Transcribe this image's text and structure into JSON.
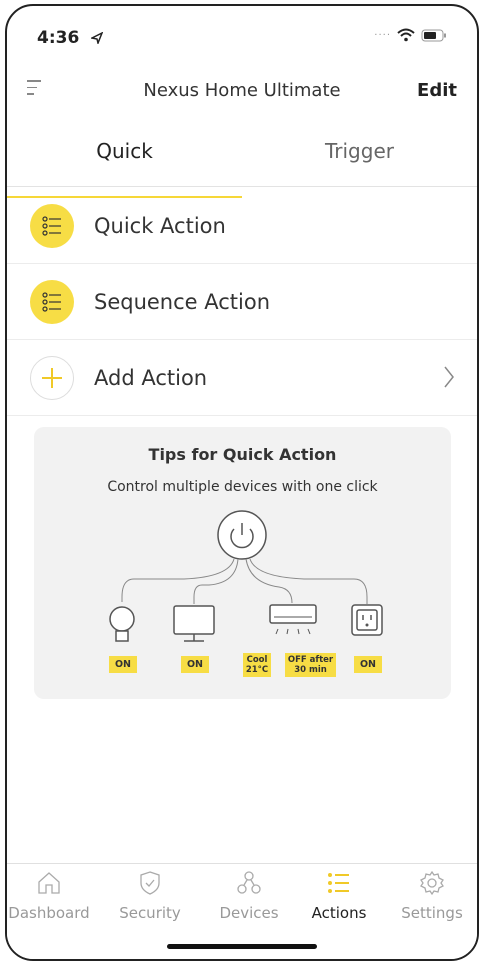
{
  "status": {
    "time": "4:36"
  },
  "nav": {
    "title": "Nexus Home Ultimate",
    "edit_label": "Edit"
  },
  "tabs": [
    {
      "label": "Quick"
    },
    {
      "label": "Trigger"
    }
  ],
  "actions": [
    {
      "label": "Quick Action",
      "icon": "list-icon"
    },
    {
      "label": "Sequence Action",
      "icon": "list-icon"
    },
    {
      "label": "Add Action",
      "icon": "plus-icon"
    }
  ],
  "tips": {
    "title": "Tips for Quick Action",
    "subtitle": "Control multiple devices with one click",
    "badges": [
      "ON",
      "ON",
      "Cool\n21°C",
      "OFF after\n30 min",
      "ON"
    ]
  },
  "tabbar": [
    {
      "label": "Dashboard",
      "icon": "home-icon"
    },
    {
      "label": "Security",
      "icon": "shield-icon"
    },
    {
      "label": "Devices",
      "icon": "devices-icon"
    },
    {
      "label": "Actions",
      "icon": "list-icon"
    },
    {
      "label": "Settings",
      "icon": "gear-icon"
    }
  ],
  "colors": {
    "accent": "#f7dd45",
    "tip_bg": "#f2f2f2"
  }
}
